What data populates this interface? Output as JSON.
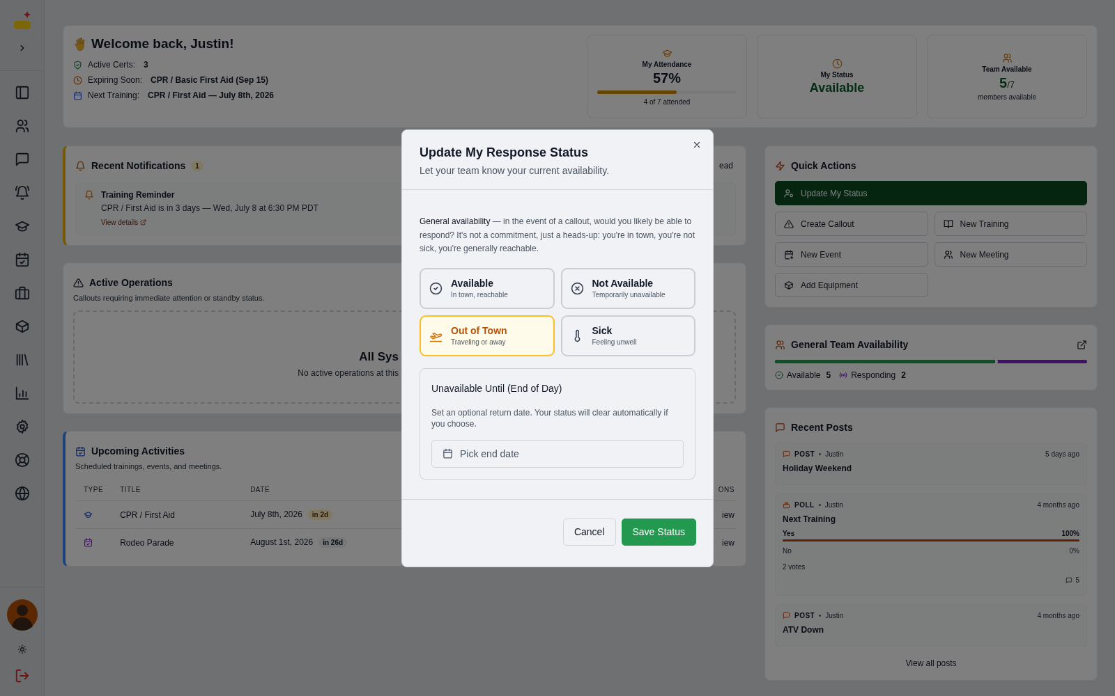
{
  "welcome": {
    "title": "Welcome back, Justin!",
    "facts": [
      {
        "kind": "certs",
        "label": "Active Certs:",
        "value": "3"
      },
      {
        "kind": "expiring",
        "label": "Expiring Soon:",
        "value": "CPR / Basic First Aid (Sep 15)"
      },
      {
        "kind": "training",
        "label": "Next Training:",
        "value": "CPR / First Aid — July 8th, 2026"
      }
    ]
  },
  "stats": [
    {
      "kind": "attendance",
      "label": "My Attendance",
      "value": "57%",
      "level": 0.57,
      "caption": "4 of 7 attended"
    },
    {
      "kind": "status",
      "label": "My Status",
      "value": "Available"
    },
    {
      "kind": "team",
      "label": "Team Available",
      "value": "5",
      "total": "/7",
      "caption": "members available"
    }
  ],
  "notifications": {
    "title": "Recent Notifications",
    "count": "1",
    "action": "ead",
    "items": [
      {
        "title": "Training Reminder",
        "text": "CPR / First Aid is in 3 days — Wed, July 8 at 6:30 PM PDT",
        "link": "View details"
      }
    ]
  },
  "operations": {
    "title": "Active Operations",
    "subtitle": "Callouts requiring immediate attention or standby status.",
    "empty_title": "All Sys",
    "empty_text": "No active operations at this"
  },
  "upcoming": {
    "title": "Upcoming Activities",
    "subtitle": "Scheduled trainings, events, and meetings.",
    "columns": [
      "TYPE",
      "TITLE",
      "DATE",
      "ONS"
    ],
    "rows": [
      {
        "kind": "training",
        "title": "CPR / First Aid",
        "date": "July 8th, 2026",
        "badge": "in 2d",
        "urgent": true,
        "action": "iew"
      },
      {
        "kind": "event",
        "title": "Rodeo Parade",
        "date": "August 1st, 2026",
        "badge": "in 26d",
        "urgent": false,
        "action": "iew"
      }
    ]
  },
  "quick_actions": {
    "title": "Quick Actions",
    "buttons": [
      {
        "kind": "status",
        "label": "Update My Status",
        "primary": true
      },
      {
        "kind": "callout",
        "label": "Create Callout",
        "primary": false
      },
      {
        "kind": "training",
        "label": "New Training",
        "primary": false
      },
      {
        "kind": "event",
        "label": "New Event",
        "primary": false
      },
      {
        "kind": "meeting",
        "label": "New Meeting",
        "primary": false
      },
      {
        "kind": "equipment",
        "label": "Add Equipment",
        "primary": false
      }
    ]
  },
  "team_availability": {
    "title": "General Team Availability",
    "groups": [
      {
        "kind": "available",
        "label": "Available",
        "count": "5",
        "level": 0.714
      },
      {
        "kind": "responding",
        "label": "Responding",
        "count": "2"
      }
    ]
  },
  "recent_posts": {
    "title": "Recent Posts",
    "posts": [
      {
        "kind": "post",
        "type": "POST",
        "author": "Justin",
        "time": "5 days ago",
        "title": "Holiday Weekend"
      },
      {
        "kind": "poll",
        "type": "POLL",
        "author": "Justin",
        "time": "4 months ago",
        "title": "Next Training",
        "options": [
          {
            "label": "Yes",
            "percent": "100%",
            "level": 1
          },
          {
            "label": "No",
            "percent": "0%"
          }
        ],
        "votes": "2 votes",
        "comments": "5"
      },
      {
        "kind": "post",
        "type": "POST",
        "author": "Justin",
        "time": "4 months ago",
        "title": "ATV Down"
      }
    ],
    "view_all": "View all posts"
  },
  "modal": {
    "title": "Update My Response Status",
    "subtitle": "Let your team know your current availability.",
    "intro": "**General availability** — in the event of a callout, would you likely be able to respond? It's not a commitment, just a heads-up: you're in town, you're not sick, you're generally reachable.",
    "options": [
      {
        "kind": "available",
        "label": "Available",
        "hint": "In town, reachable",
        "selected": false
      },
      {
        "kind": "not_available",
        "label": "Not Available",
        "hint": "Temporarily unavailable",
        "selected": false
      },
      {
        "kind": "out_of_town",
        "label": "Out of Town",
        "hint": "Traveling or away",
        "selected": true
      },
      {
        "kind": "sick",
        "label": "Sick",
        "hint": "Feeling unwell",
        "selected": false
      }
    ],
    "until": {
      "title": "Unavailable Until (End of Day)",
      "text": "Set an optional return date. Your status will clear automatically if you choose.",
      "date_field": {
        "placeholder": "Pick end date"
      }
    },
    "buttons": [
      {
        "kind": "cancel",
        "label": "Cancel"
      },
      {
        "kind": "save",
        "label": "Save Status"
      }
    ]
  }
}
